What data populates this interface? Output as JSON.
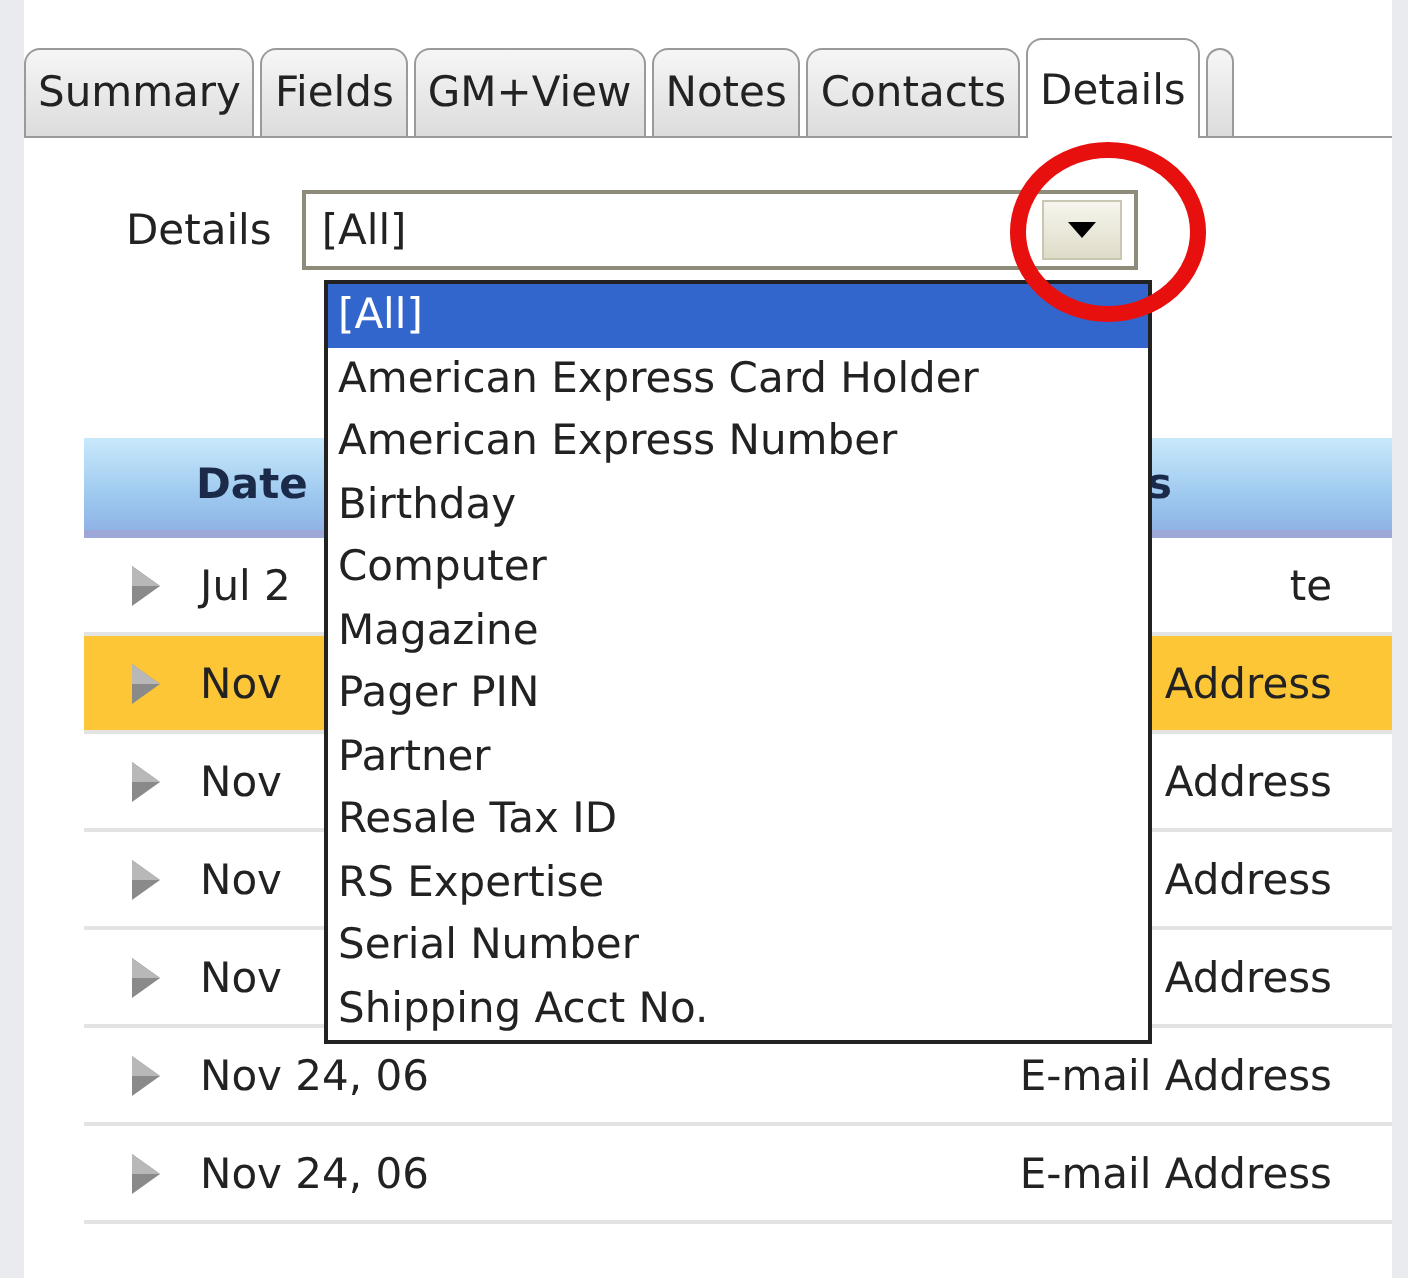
{
  "tabs": [
    {
      "label": "Summary",
      "selected": false
    },
    {
      "label": "Fields",
      "selected": false
    },
    {
      "label": "GM+View",
      "selected": false
    },
    {
      "label": "Notes",
      "selected": false
    },
    {
      "label": "Contacts",
      "selected": false
    },
    {
      "label": "Details",
      "selected": true
    },
    {
      "selected": false
    }
  ],
  "filter": {
    "label": "Details",
    "value": "[All]"
  },
  "dropdown": {
    "items": [
      {
        "label": "[All]",
        "selected": true
      },
      {
        "label": "American Express Card Holder",
        "selected": false
      },
      {
        "label": "American Express Number",
        "selected": false
      },
      {
        "label": "Birthday",
        "selected": false
      },
      {
        "label": "Computer",
        "selected": false
      },
      {
        "label": "Magazine",
        "selected": false
      },
      {
        "label": "Pager PIN",
        "selected": false
      },
      {
        "label": "Partner",
        "selected": false
      },
      {
        "label": "Resale Tax ID",
        "selected": false
      },
      {
        "label": "RS Expertise",
        "selected": false
      },
      {
        "label": "Serial Number",
        "selected": false
      },
      {
        "label": "Shipping Acct No.",
        "selected": false
      }
    ]
  },
  "table": {
    "columns": [
      "Date",
      "s"
    ],
    "rows": [
      {
        "cells": [
          "Jul 2",
          "te"
        ],
        "selected": false
      },
      {
        "cells": [
          "Nov",
          "Address"
        ],
        "selected": true
      },
      {
        "cells": [
          "Nov",
          "Address"
        ],
        "selected": false
      },
      {
        "cells": [
          "Nov",
          "Address"
        ],
        "selected": false
      },
      {
        "cells": [
          "Nov",
          "Address"
        ],
        "selected": false
      },
      {
        "cells": [
          "Nov 24, 06",
          "E-mail Address"
        ],
        "selected": false
      },
      {
        "cells": [
          "Nov 24, 06",
          "E-mail Address"
        ],
        "selected": false
      }
    ]
  }
}
